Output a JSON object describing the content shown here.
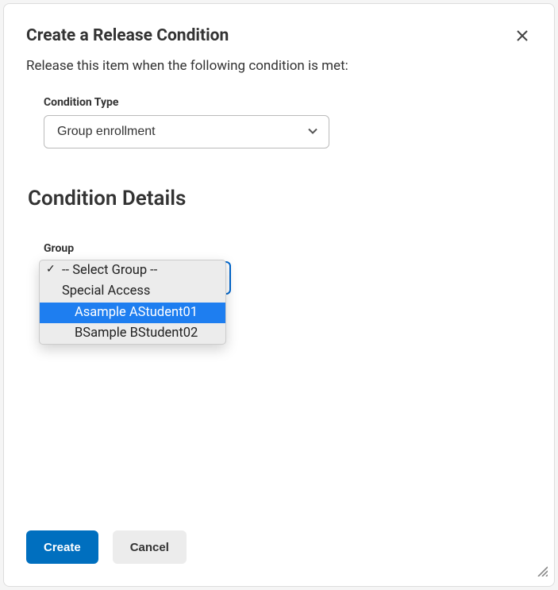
{
  "dialog": {
    "title": "Create a Release Condition",
    "subtitle": "Release this item when the following condition is met:"
  },
  "condition_type": {
    "label": "Condition Type",
    "value": "Group enrollment"
  },
  "details": {
    "heading": "Condition Details"
  },
  "group": {
    "label": "Group",
    "selected": "-- Select Group --",
    "options": [
      {
        "label": "-- Select Group --",
        "indent": false,
        "checked": true,
        "hover": false
      },
      {
        "label": "Special Access",
        "indent": false,
        "checked": false,
        "hover": false
      },
      {
        "label": "Asample AStudent01",
        "indent": true,
        "checked": false,
        "hover": true
      },
      {
        "label": "BSample BStudent02",
        "indent": true,
        "checked": false,
        "hover": false
      }
    ]
  },
  "buttons": {
    "create": "Create",
    "cancel": "Cancel"
  }
}
